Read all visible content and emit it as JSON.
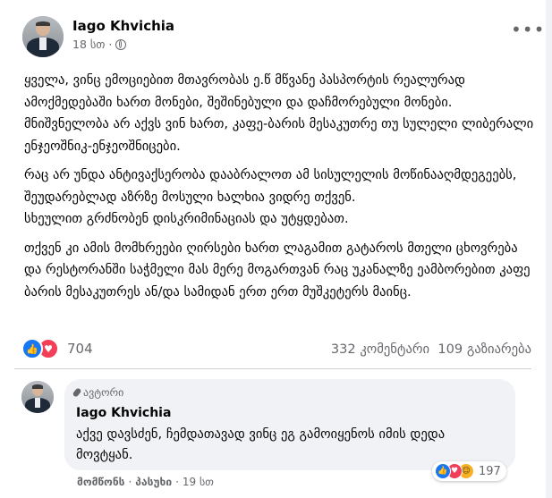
{
  "post": {
    "author": "Iago Khvichia",
    "time": "18 სთ",
    "separator": "·",
    "icons": {
      "privacy": "globe-icon",
      "menu": "more-horizontal-icon"
    },
    "paragraphs": [
      "ყველა, ვინც ემოციებით მთავრობას ე.წ მწვანე პასპორტის რეალურად ამოქმედებაში ხართ მონები, შეშინებული და დაჩმორებული მონები. მნიშვნელობა არ აქვს ვინ ხართ, კაფე-ბარის მესაკუთრე თუ სულელი ლიბერალი ენჯეოშნიკ-ენჯეოშნიცები.",
      "რაც არ უნდა ანტივაქსერობა დააბრალოთ ამ სისულელის მოწინააღმდეგეებს, შეუდარებლად აზრზე მოსული ხალხია ვიდრე თქვენ.",
      "სხეულით გრძნობენ დისკრიმინაციას და უტყდებათ.",
      "თქვენ კი ამის მომხრეები ღირსები ხართ ლაგამით გატაროს მთელი ცხოვრება და რესტორანში საჭმელი მას მერე მოგართვან რაც უკანალზე ეამბორებით კაფე ბარის მესაკუთრეს ან/და სამიდან ერთ ერთ მუშკეტერს მაინც."
    ],
    "reaction_count": "704",
    "comments_count": "332 კომენტარი",
    "shares_count": "109 გაზიარება"
  },
  "comment": {
    "badge": "ავტორი",
    "author": "Iago Khvichia",
    "text": "აქვე დავსძენ, ჩემდათავად ვინც ეგ გამოიყენოს იმის დედა მოვტყან.",
    "reaction_count": "197",
    "like_label": "მომწონს",
    "reply_label": "პასუხი",
    "time": "19 სთ",
    "separator": "·"
  },
  "colors": {
    "like": "#1877f2",
    "love": "#f33e58",
    "haha": "#f7b125",
    "meta": "#65676b",
    "bubble": "#f0f2f5"
  }
}
